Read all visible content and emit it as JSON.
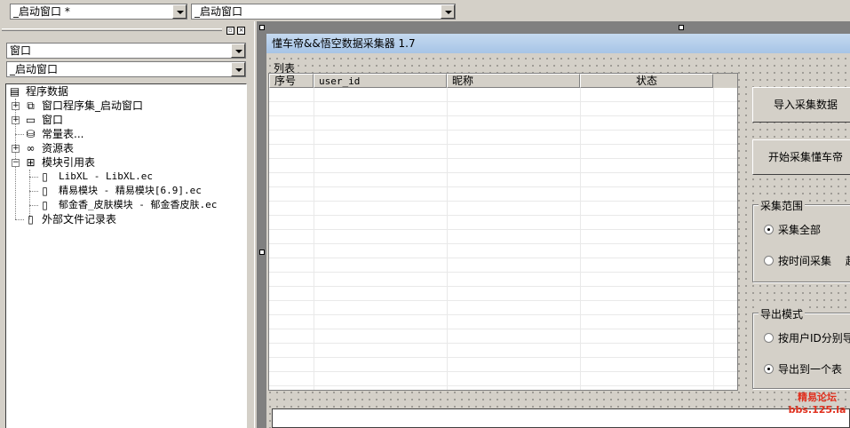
{
  "toolbar": {
    "window_combo": "_启动窗口 *",
    "event_combo": "_启动窗口"
  },
  "left_pane": {
    "pin_glyph": "▫",
    "close_glyph": "×",
    "type_combo": "窗口",
    "object_combo": "_启动窗口",
    "tree": {
      "root": "程序数据",
      "items": [
        {
          "label": "窗口程序集_启动窗口",
          "icon": "stack-icon"
        },
        {
          "label": "窗口",
          "icon": "window-icon"
        },
        {
          "label": "常量表...",
          "icon": "constant-table-icon"
        },
        {
          "label": "资源表",
          "icon": "resource-icon"
        },
        {
          "label": "模块引用表",
          "icon": "module-ref-icon"
        }
      ],
      "modules": [
        "LibXL - LibXL.ec",
        "精易模块 - 精易模块[6.9].ec",
        "郁金香_皮肤模块 - 郁金香皮肤.ec"
      ],
      "external": "外部文件记录表"
    }
  },
  "form": {
    "title": "懂车帝&&悟空数据采集器 1.7",
    "list_label": "列表",
    "columns": [
      "序号",
      "user_id",
      "昵称",
      "状态"
    ],
    "import_button": "导入采集数据",
    "start_button": "开始采集懂车帝",
    "scope_group": {
      "title": "采集范围",
      "options": [
        {
          "label": "采集全部",
          "selected": true
        },
        {
          "label": "按时间采集",
          "selected": false
        }
      ],
      "extra": "起"
    },
    "export_group": {
      "title": "导出模式",
      "options": [
        {
          "label": "按用户ID分别导",
          "selected": false
        },
        {
          "label": "导出到一个表",
          "selected": true
        }
      ]
    }
  },
  "watermark": {
    "line1": "精易论坛",
    "line2": "bbs.125.la"
  }
}
